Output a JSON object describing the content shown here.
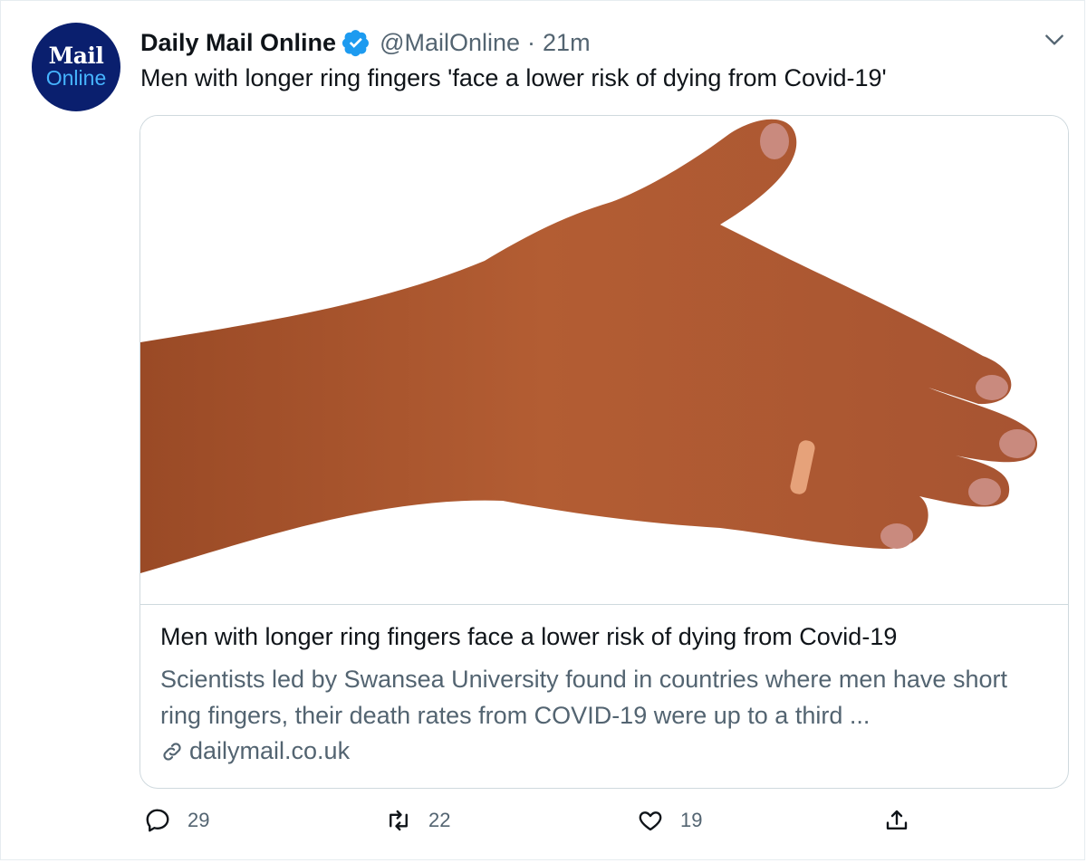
{
  "tweet": {
    "avatar": {
      "line1": "Mail",
      "line2": "Online"
    },
    "author_name": "Daily Mail Online",
    "handle": "@MailOnline",
    "separator": "·",
    "time": "21m",
    "text": "Men with longer ring fingers 'face a lower risk of dying from Covid-19'",
    "card": {
      "title": "Men with longer ring fingers face a lower risk of dying from Covid-19",
      "description": "Scientists led by Swansea University found in countries where men have short ring fingers, their death rates from COVID-19 were up to a third ...",
      "domain": "dailymail.co.uk",
      "image": "hand-photo"
    },
    "actions": {
      "replies": "29",
      "retweets": "22",
      "likes": "19"
    },
    "icons": [
      "verified-icon",
      "chevron-down-icon",
      "link-icon",
      "reply-icon",
      "retweet-icon",
      "like-icon",
      "share-icon"
    ],
    "colors": {
      "verified": "#1d9bf0",
      "avatar_bg": "#0a1f6e",
      "avatar_accent": "#46b4ff",
      "muted": "#536471"
    }
  }
}
